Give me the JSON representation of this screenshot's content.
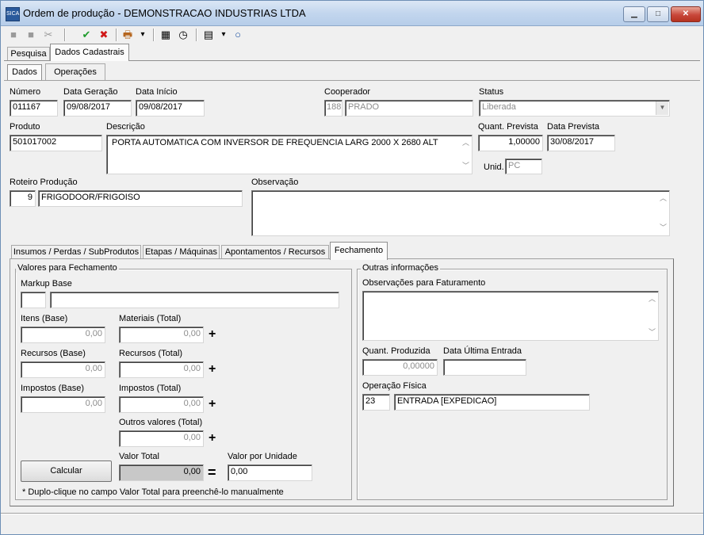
{
  "window": {
    "icon_text": "SICA",
    "title": "Ordem de produção - DEMONSTRACAO INDUSTRIAS LTDA",
    "minimize_glyph": "▁",
    "maximize_glyph": "□",
    "close_glyph": "✕"
  },
  "toolbar": {
    "new_glyph": "■",
    "save_glyph": "■",
    "cut_glyph": "✂",
    "confirm_glyph": "✔",
    "cancel_glyph": "✖",
    "print_glyph": "🖶",
    "dropdown_glyph": "▾",
    "calc_glyph": "▦",
    "clock_glyph": "◷",
    "grid_glyph": "▤",
    "circle_glyph": "○"
  },
  "top_tabs": [
    "Pesquisa",
    "Dados Cadastrais"
  ],
  "sub_tabs": [
    "Dados",
    "Operações"
  ],
  "fields": {
    "numero_label": "Número",
    "numero": "011167",
    "data_geracao_label": "Data Geração",
    "data_geracao": "09/08/2017",
    "data_inicio_label": "Data Início",
    "data_inicio": "09/08/2017",
    "cooperador_label": "Cooperador",
    "cooperador_code": "188",
    "cooperador_name": "PRADO",
    "status_label": "Status",
    "status": "Liberada",
    "produto_label": "Produto",
    "produto": "501017002",
    "descricao_label": "Descrição",
    "descricao": "PORTA AUTOMATICA COM INVERSOR DE FREQUENCIA  LARG 2000 X 2680 ALT",
    "quant_prevista_label": "Quant. Prevista",
    "quant_prevista": "1,00000",
    "data_prevista_label": "Data Prevista",
    "data_prevista": "30/08/2017",
    "unid_label": "Unid.",
    "unid": "PC",
    "roteiro_label": "Roteiro Produção",
    "roteiro_code": "9",
    "roteiro_name": "FRIGODOOR/FRIGOISO",
    "observacao_label": "Observação",
    "observacao": ""
  },
  "bottom_tabs": [
    "Insumos / Perdas / SubProdutos",
    "Etapas / Máquinas",
    "Apontamentos / Recursos",
    "Fechamento"
  ],
  "fechamento": {
    "group_title": "Valores para Fechamento",
    "markup_label": "Markup Base",
    "markup_code": "",
    "markup_name": "",
    "itens_base_label": "Itens (Base)",
    "itens_base": "0,00",
    "materiais_total_label": "Materiais (Total)",
    "materiais_total": "0,00",
    "recursos_base_label": "Recursos (Base)",
    "recursos_base": "0,00",
    "recursos_total_label": "Recursos (Total)",
    "recursos_total": "0,00",
    "impostos_base_label": "Impostos (Base)",
    "impostos_base": "0,00",
    "impostos_total_label": "Impostos (Total)",
    "impostos_total": "0,00",
    "outros_total_label": "Outros valores (Total)",
    "outros_total": "0,00",
    "plus": "+",
    "equals": "=",
    "calcular_label": "Calcular",
    "valor_total_label": "Valor Total",
    "valor_total": "0,00",
    "valor_unidade_label": "Valor por Unidade",
    "valor_unidade": "0,00",
    "hint": "* Duplo-clique no campo Valor Total para preenchê-lo manualmente"
  },
  "outras": {
    "group_title": "Outras informações",
    "obs_faturamento_label": "Observações para Faturamento",
    "obs_faturamento": "",
    "quant_produzida_label": "Quant. Produzida",
    "quant_produzida": "0,00000",
    "data_ultima_label": "Data Última Entrada",
    "data_ultima": "",
    "operacao_label": "Operação Física",
    "operacao_code": "23",
    "operacao_name": "ENTRADA [EXPEDICAO]"
  }
}
